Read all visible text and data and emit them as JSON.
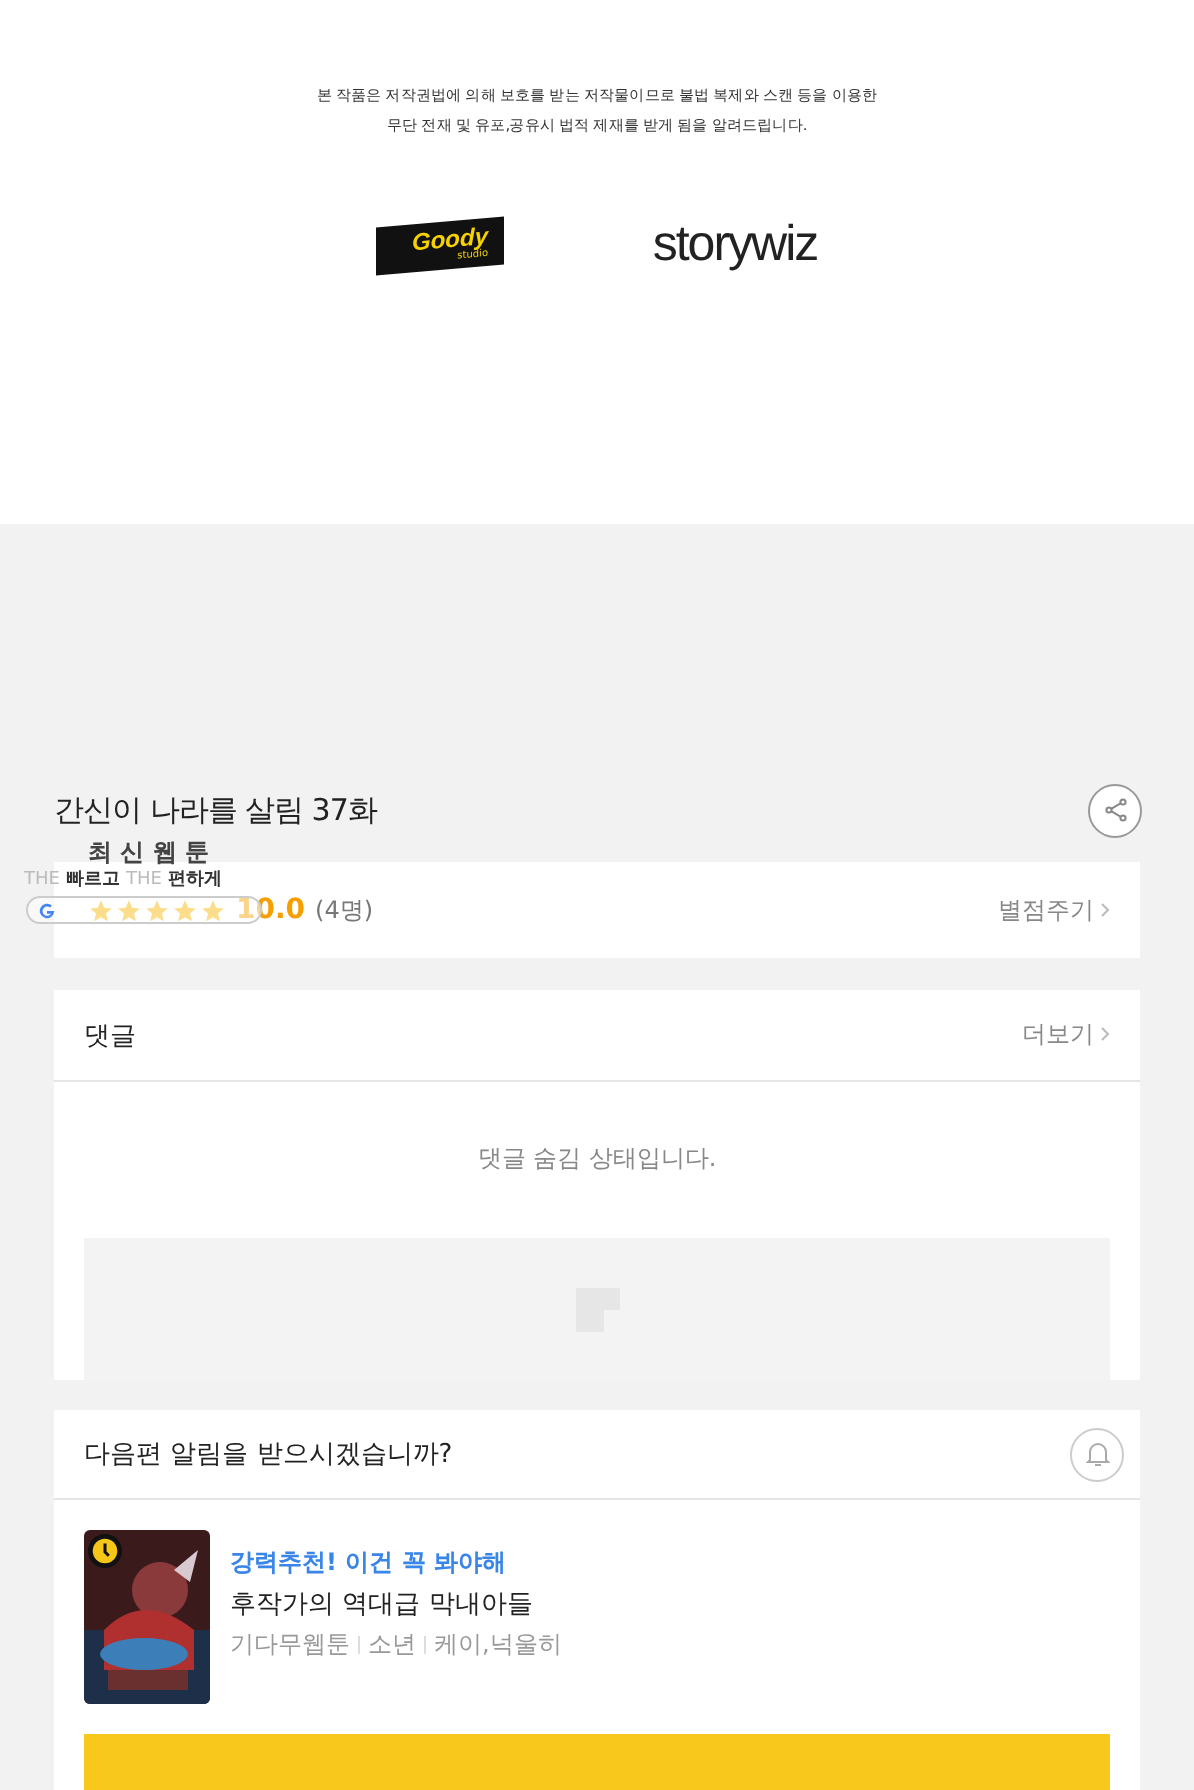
{
  "notice": {
    "lines": [
      "본 작품은 저작권법에 의해 보호를 받는 저작물이므로 불법 복제와 스캔 등을 이용한",
      "무단 전재 및 유포,공유시 법적 제재를 받게 됨을 알려드립니다."
    ]
  },
  "logos": [
    {
      "kind": "goody",
      "name": "Goody",
      "sub": "studio"
    },
    {
      "kind": "storywiz",
      "name": "storywiz"
    }
  ],
  "episode": {
    "title": "간신이 나라를 살림 37화"
  },
  "rating": {
    "stars": 5,
    "score": "10.0",
    "count": "(4명)",
    "action": "별점주기"
  },
  "ad_overlay": {
    "title": "최 신 웹 툰",
    "tagline": [
      {
        "text": "THE",
        "bold": false
      },
      {
        "text": "빠르고",
        "bold": true
      },
      {
        "text": "THE",
        "bold": false
      },
      {
        "text": "편하게",
        "bold": true
      }
    ]
  },
  "comments": {
    "title": "댓글",
    "more": "더보기",
    "message": "댓글 숨김 상태입니다."
  },
  "notify": {
    "question": "다음편 알림을 받으시겠습니까?",
    "on": false
  },
  "recommendation": {
    "tag": "강력추천! 이건 꼭 봐야해",
    "title": "후작가의 역대급 막내아들",
    "meta": [
      "기다무웹툰",
      "소년",
      "케이,넉울히"
    ],
    "waitfree": true
  }
}
